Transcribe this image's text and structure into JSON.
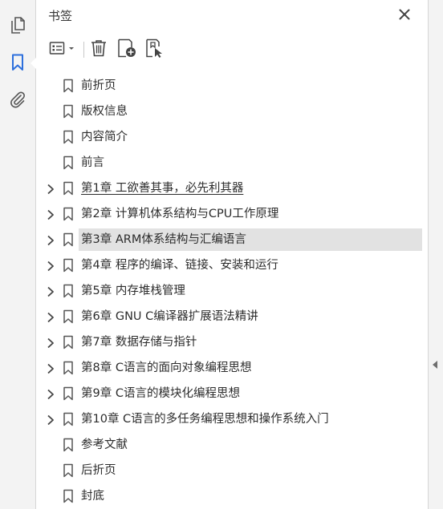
{
  "panel": {
    "title": "书签",
    "accent_color": "#2d6fdc"
  },
  "rail": {
    "items": [
      {
        "icon": "page-thumbnails-icon"
      },
      {
        "icon": "bookmarks-icon",
        "active": true
      },
      {
        "icon": "attachments-icon"
      }
    ]
  },
  "toolbar": {
    "items": [
      {
        "icon": "options-menu-icon"
      },
      {
        "icon": "trash-icon"
      },
      {
        "icon": "new-bookmark-icon"
      },
      {
        "icon": "find-current-bookmark-icon"
      }
    ]
  },
  "bookmarks": [
    {
      "label": "前折页",
      "expandable": false
    },
    {
      "label": "版权信息",
      "expandable": false
    },
    {
      "label": "内容简介",
      "expandable": false
    },
    {
      "label": "前言",
      "expandable": false
    },
    {
      "label": "第1章 工欲善其事，必先利其器",
      "expandable": true,
      "underlined": true
    },
    {
      "label": "第2章 计算机体系结构与CPU工作原理",
      "expandable": true
    },
    {
      "label": "第3章 ARM体系结构与汇编语言",
      "expandable": true,
      "selected": true
    },
    {
      "label": "第4章 程序的编译、链接、安装和运行",
      "expandable": true
    },
    {
      "label": "第5章 内存堆栈管理",
      "expandable": true
    },
    {
      "label": "第6章 GNU C编译器扩展语法精讲",
      "expandable": true
    },
    {
      "label": "第7章 数据存储与指针",
      "expandable": true
    },
    {
      "label": "第8章 C语言的面向对象编程思想",
      "expandable": true
    },
    {
      "label": "第9章 C语言的模块化编程思想",
      "expandable": true
    },
    {
      "label": "第10章 C语言的多任务编程思想和操作系统入门",
      "expandable": true
    },
    {
      "label": "参考文献",
      "expandable": false
    },
    {
      "label": "后折页",
      "expandable": false
    },
    {
      "label": "封底",
      "expandable": false
    }
  ]
}
